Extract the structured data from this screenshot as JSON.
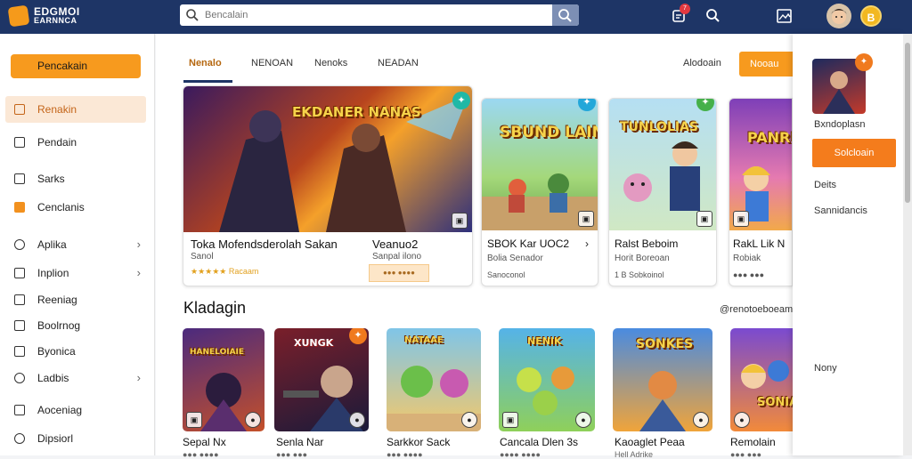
{
  "header": {
    "logo_line1": "EDGMOI",
    "logo_line2": "EARNNCA",
    "search_placeholder": "Bencalain",
    "notification_count": "7",
    "coin_symbol": "B"
  },
  "sidebar": {
    "cta_label": "Pencakain",
    "items": [
      {
        "label": "Renakin",
        "active": true
      },
      {
        "label": "Pendain"
      },
      {
        "label": "Sarks"
      },
      {
        "label": "Cenclanis"
      },
      {
        "label": "Aplika",
        "chevron": true
      },
      {
        "label": "Inplion",
        "chevron": true
      },
      {
        "label": "Reeniag"
      },
      {
        "label": "Boolrnog"
      },
      {
        "label": "Byonica"
      },
      {
        "label": "Ladbis",
        "chevron": true
      },
      {
        "label": "Aoceniag"
      },
      {
        "label": "Dipsiorl"
      }
    ],
    "chevron_glyph": "›"
  },
  "main": {
    "tabs": [
      "Nenalo",
      "NENOAN",
      "Nenoks",
      "NEADAN"
    ],
    "header_link": "Alodoain",
    "header_button": "Nooau",
    "featured": [
      {
        "cover": "EKDANER NANAS",
        "title": "Toka Mofendsderolah Sakan",
        "sub": "Sanol",
        "rating": "★★★★★ Racaam",
        "title2": "Veanuo2",
        "sub2": "Sanpal ilono",
        "pill": "●●● ●●●●"
      },
      {
        "cover": "SBUND LAINAI",
        "title": "SBOK Kar UOC2",
        "sub": "Bolia Senador",
        "meta": "Sanoconol",
        "arrow": "›"
      },
      {
        "cover": "TUNLOLIAS",
        "title": "Ralst Beboim",
        "sub": "Horit Boreoan",
        "meta": "1 B Sobkoinol"
      },
      {
        "cover": "PANRIA",
        "title": "RakL Lik N",
        "sub": "Robiak",
        "meta": "●●● ●●●"
      }
    ],
    "section_title": "Kladagin",
    "section_link": "@renotoeboeam",
    "tiles": [
      {
        "cover": "HANELOIAIE",
        "name": "Sepal Nx",
        "sub": "●●● ●●●●"
      },
      {
        "cover": "XUNGK",
        "name": "Senla Nar",
        "sub": "●●● ●●●"
      },
      {
        "cover": "NATAAE",
        "name": "Sarkkor Sack",
        "sub": "●●● ●●●●"
      },
      {
        "cover": "NENIK",
        "name": "Cancala Dlen 3s",
        "sub": "●●●● ●●●●"
      },
      {
        "cover": "SONKES",
        "name": "Kaoaglet Peaa",
        "sub": "Hell Adrike"
      },
      {
        "cover": "SONIA",
        "name": "Remolain",
        "sub": "●●● ●●●"
      }
    ]
  },
  "right_panel": {
    "caption": "Bxndoplasn",
    "button": "Solcloain",
    "item1": "Deits",
    "item2": "Sannidancis",
    "item3": "Nony"
  }
}
